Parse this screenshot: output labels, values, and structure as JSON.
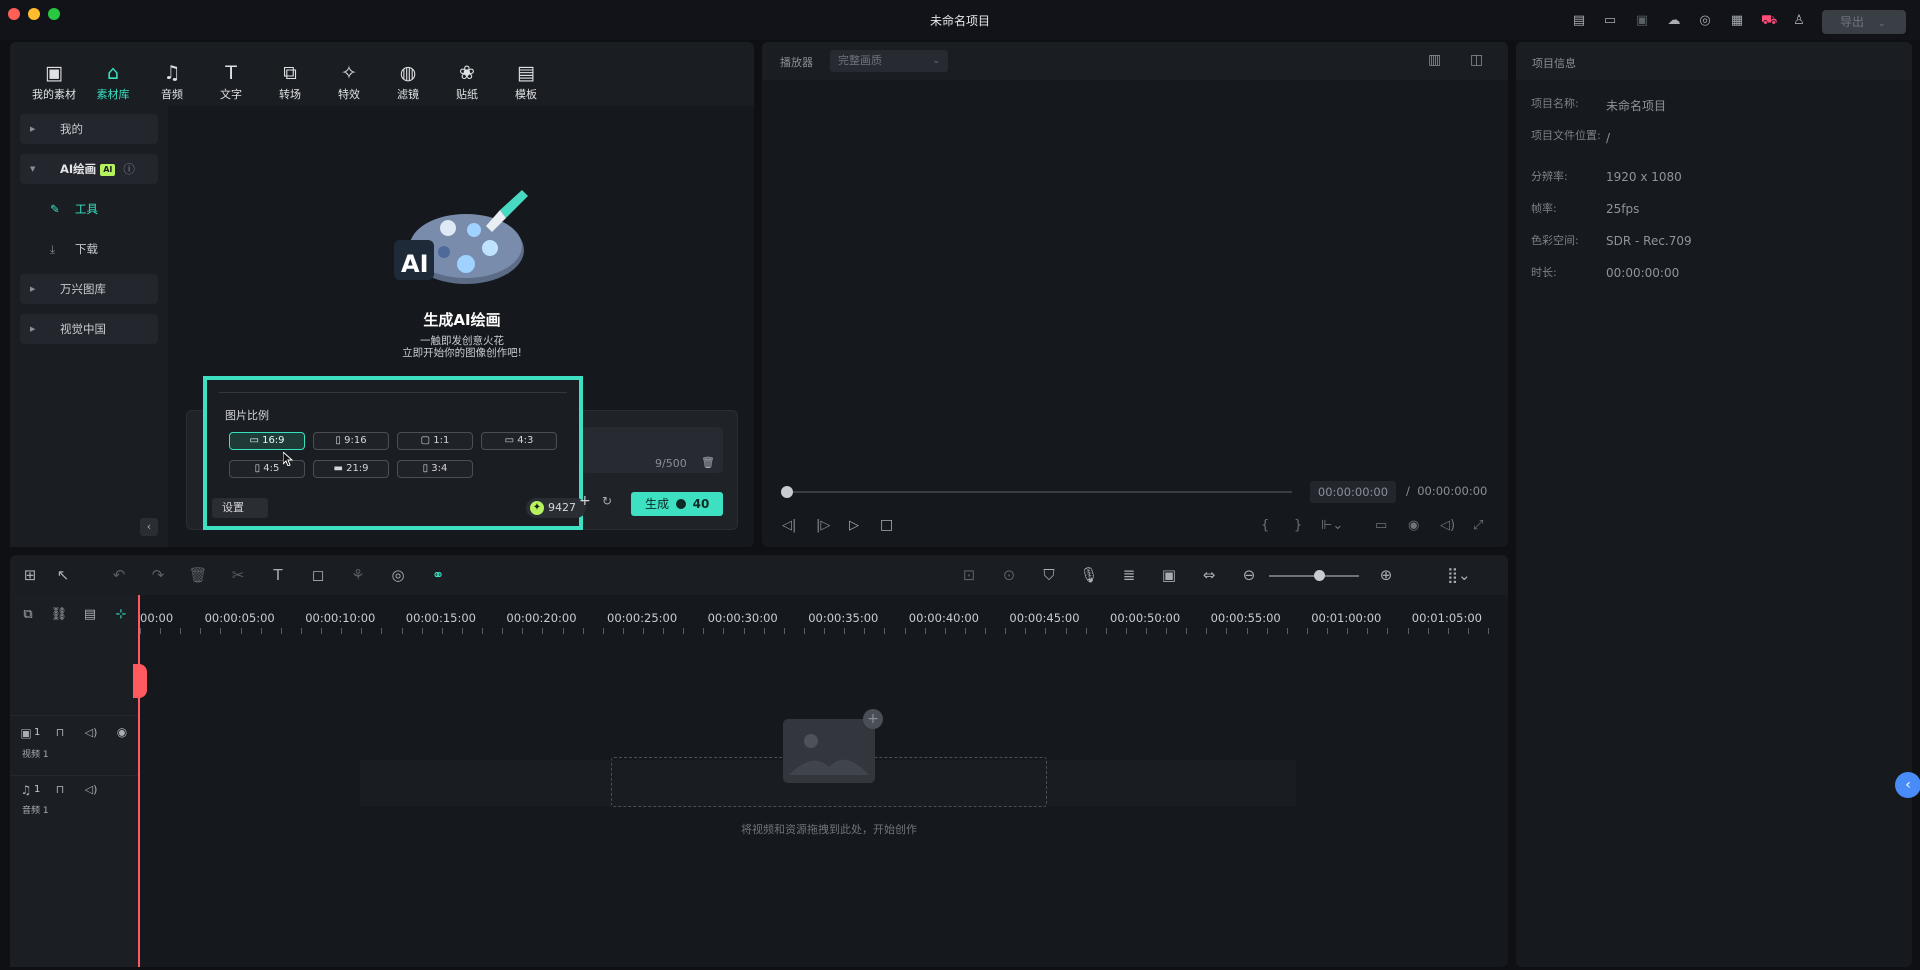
{
  "window": {
    "title": "未命名项目",
    "export_label": "导出"
  },
  "media_tabs": [
    "我的素材",
    "素材库",
    "音频",
    "文字",
    "转场",
    "特效",
    "滤镜",
    "贴纸",
    "模板"
  ],
  "sidebar": {
    "mine": "我的",
    "ai_painting": "AI绘画",
    "ai_badge": "AI",
    "tools": "工具",
    "download": "下载",
    "ws_library": "万兴图库",
    "vcg": "视觉中国"
  },
  "ai_painting": {
    "heading": "生成AI绘画",
    "subtitle_1": "一触即发创意火花",
    "subtitle_2": "立即开始你的图像创作吧!"
  },
  "ratio_popup": {
    "label": "图片比例",
    "ratios": [
      "16:9",
      "9:16",
      "1:1",
      "4:3",
      "4:5",
      "21:9",
      "3:4"
    ],
    "selected": "16:9",
    "settings": "设置",
    "credits": "9427"
  },
  "prompt": {
    "char_count": "9/500",
    "generate_label": "生成",
    "generate_cost": "40"
  },
  "player": {
    "label": "播放器",
    "quality": "完整画质",
    "current_time": "00:00:00:00",
    "separator": "/",
    "total_time": "00:00:00:00"
  },
  "project_info": {
    "title": "项目信息",
    "rows": [
      {
        "label": "项目名称:",
        "value": "未命名项目"
      },
      {
        "label": "项目文件位置:",
        "value": "/"
      },
      {
        "label": "分辨率:",
        "value": "1920 x 1080"
      },
      {
        "label": "帧率:",
        "value": "25fps"
      },
      {
        "label": "色彩空间:",
        "value": "SDR - Rec.709"
      },
      {
        "label": "时长:",
        "value": "00:00:00:00"
      }
    ]
  },
  "timeline": {
    "ruler": [
      "00:00",
      "00:00:05:00",
      "00:00:10:00",
      "00:00:15:00",
      "00:00:20:00",
      "00:00:25:00",
      "00:00:30:00",
      "00:00:35:00",
      "00:00:40:00",
      "00:00:45:00",
      "00:00:50:00",
      "00:00:55:00",
      "00:01:00:00",
      "00:01:05:00"
    ],
    "tracks": [
      {
        "number": "1",
        "name": "视频 1"
      },
      {
        "number": "1",
        "name": "音频 1"
      }
    ],
    "drop_hint": "将视频和资源拖拽到此处，开始创作"
  },
  "colors": {
    "accent": "#3de0c0",
    "playhead": "#ff5a5f",
    "badge": "#b5f25d"
  }
}
